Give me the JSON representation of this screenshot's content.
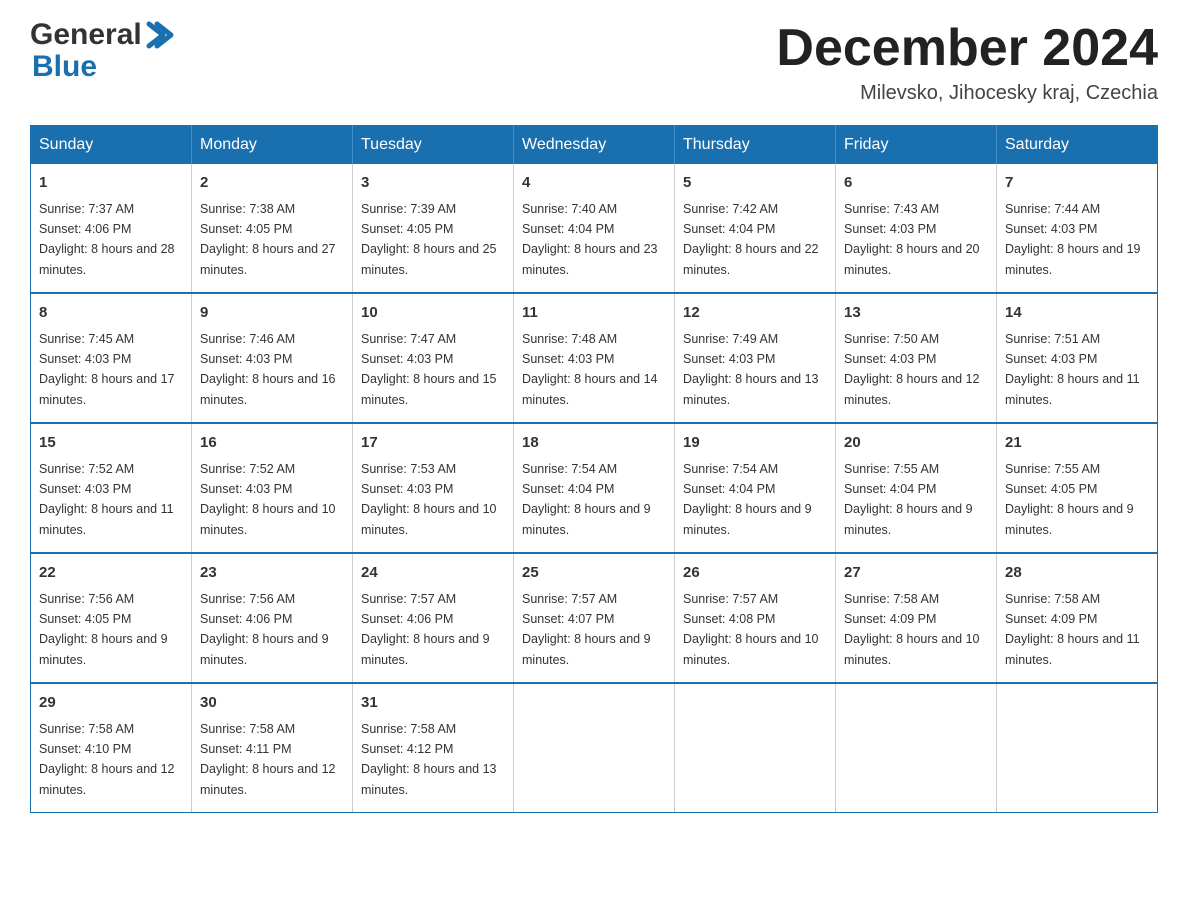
{
  "header": {
    "title": "December 2024",
    "location": "Milevsko, Jihocesky kraj, Czechia"
  },
  "days_of_week": [
    "Sunday",
    "Monday",
    "Tuesday",
    "Wednesday",
    "Thursday",
    "Friday",
    "Saturday"
  ],
  "weeks": [
    [
      {
        "day": "1",
        "sunrise": "7:37 AM",
        "sunset": "4:06 PM",
        "daylight": "8 hours and 28 minutes."
      },
      {
        "day": "2",
        "sunrise": "7:38 AM",
        "sunset": "4:05 PM",
        "daylight": "8 hours and 27 minutes."
      },
      {
        "day": "3",
        "sunrise": "7:39 AM",
        "sunset": "4:05 PM",
        "daylight": "8 hours and 25 minutes."
      },
      {
        "day": "4",
        "sunrise": "7:40 AM",
        "sunset": "4:04 PM",
        "daylight": "8 hours and 23 minutes."
      },
      {
        "day": "5",
        "sunrise": "7:42 AM",
        "sunset": "4:04 PM",
        "daylight": "8 hours and 22 minutes."
      },
      {
        "day": "6",
        "sunrise": "7:43 AM",
        "sunset": "4:03 PM",
        "daylight": "8 hours and 20 minutes."
      },
      {
        "day": "7",
        "sunrise": "7:44 AM",
        "sunset": "4:03 PM",
        "daylight": "8 hours and 19 minutes."
      }
    ],
    [
      {
        "day": "8",
        "sunrise": "7:45 AM",
        "sunset": "4:03 PM",
        "daylight": "8 hours and 17 minutes."
      },
      {
        "day": "9",
        "sunrise": "7:46 AM",
        "sunset": "4:03 PM",
        "daylight": "8 hours and 16 minutes."
      },
      {
        "day": "10",
        "sunrise": "7:47 AM",
        "sunset": "4:03 PM",
        "daylight": "8 hours and 15 minutes."
      },
      {
        "day": "11",
        "sunrise": "7:48 AM",
        "sunset": "4:03 PM",
        "daylight": "8 hours and 14 minutes."
      },
      {
        "day": "12",
        "sunrise": "7:49 AM",
        "sunset": "4:03 PM",
        "daylight": "8 hours and 13 minutes."
      },
      {
        "day": "13",
        "sunrise": "7:50 AM",
        "sunset": "4:03 PM",
        "daylight": "8 hours and 12 minutes."
      },
      {
        "day": "14",
        "sunrise": "7:51 AM",
        "sunset": "4:03 PM",
        "daylight": "8 hours and 11 minutes."
      }
    ],
    [
      {
        "day": "15",
        "sunrise": "7:52 AM",
        "sunset": "4:03 PM",
        "daylight": "8 hours and 11 minutes."
      },
      {
        "day": "16",
        "sunrise": "7:52 AM",
        "sunset": "4:03 PM",
        "daylight": "8 hours and 10 minutes."
      },
      {
        "day": "17",
        "sunrise": "7:53 AM",
        "sunset": "4:03 PM",
        "daylight": "8 hours and 10 minutes."
      },
      {
        "day": "18",
        "sunrise": "7:54 AM",
        "sunset": "4:04 PM",
        "daylight": "8 hours and 9 minutes."
      },
      {
        "day": "19",
        "sunrise": "7:54 AM",
        "sunset": "4:04 PM",
        "daylight": "8 hours and 9 minutes."
      },
      {
        "day": "20",
        "sunrise": "7:55 AM",
        "sunset": "4:04 PM",
        "daylight": "8 hours and 9 minutes."
      },
      {
        "day": "21",
        "sunrise": "7:55 AM",
        "sunset": "4:05 PM",
        "daylight": "8 hours and 9 minutes."
      }
    ],
    [
      {
        "day": "22",
        "sunrise": "7:56 AM",
        "sunset": "4:05 PM",
        "daylight": "8 hours and 9 minutes."
      },
      {
        "day": "23",
        "sunrise": "7:56 AM",
        "sunset": "4:06 PM",
        "daylight": "8 hours and 9 minutes."
      },
      {
        "day": "24",
        "sunrise": "7:57 AM",
        "sunset": "4:06 PM",
        "daylight": "8 hours and 9 minutes."
      },
      {
        "day": "25",
        "sunrise": "7:57 AM",
        "sunset": "4:07 PM",
        "daylight": "8 hours and 9 minutes."
      },
      {
        "day": "26",
        "sunrise": "7:57 AM",
        "sunset": "4:08 PM",
        "daylight": "8 hours and 10 minutes."
      },
      {
        "day": "27",
        "sunrise": "7:58 AM",
        "sunset": "4:09 PM",
        "daylight": "8 hours and 10 minutes."
      },
      {
        "day": "28",
        "sunrise": "7:58 AM",
        "sunset": "4:09 PM",
        "daylight": "8 hours and 11 minutes."
      }
    ],
    [
      {
        "day": "29",
        "sunrise": "7:58 AM",
        "sunset": "4:10 PM",
        "daylight": "8 hours and 12 minutes."
      },
      {
        "day": "30",
        "sunrise": "7:58 AM",
        "sunset": "4:11 PM",
        "daylight": "8 hours and 12 minutes."
      },
      {
        "day": "31",
        "sunrise": "7:58 AM",
        "sunset": "4:12 PM",
        "daylight": "8 hours and 13 minutes."
      },
      null,
      null,
      null,
      null
    ]
  ]
}
